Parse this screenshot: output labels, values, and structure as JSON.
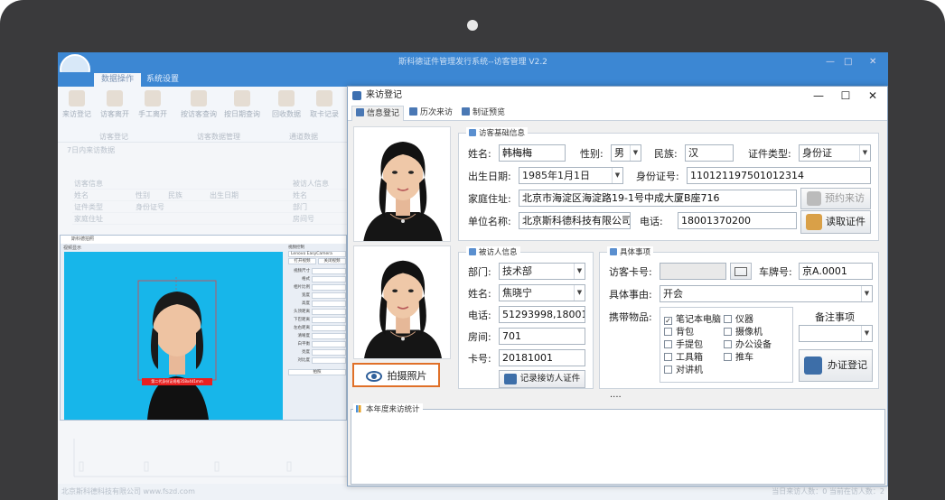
{
  "background_app": {
    "title": "斯科德证件管理发行系统--访客管理 V2.2",
    "tabs": [
      "数据操作",
      "系统设置"
    ],
    "ribbon": [
      "来访登记",
      "访客离开",
      "手工离开",
      "按访客查询",
      "按日期查询",
      "回收数据",
      "取卡记录"
    ],
    "ribbon_groups": [
      "访客登记",
      "访客数据管理",
      "通道数据"
    ],
    "panel_header": "7日内来访数据",
    "rows": [
      [
        "访客信息",
        "",
        "",
        "",
        "被访人信息"
      ],
      [
        "姓名",
        "性别",
        "民族",
        "出生日期",
        "姓名"
      ],
      [
        "证件类型",
        "身份证号",
        "",
        "",
        "部门"
      ],
      [
        "家庭住址",
        "",
        "",
        "",
        "房间号"
      ]
    ],
    "footer_left": "北京斯科德科技有限公司  www.fszd.com",
    "footer_right": "当日来访人数：0    当前在访人数：2"
  },
  "photo_tool": {
    "title": "斯科德拍照",
    "subtitle": "视频显示",
    "caption": "第二代身份证规格358x441mm",
    "camera": "Lenovo EasyCamera",
    "side_header": "视频控制",
    "side_items": [
      "视频尺寸",
      "格式",
      "相片比例",
      "宽度",
      "高度",
      "头顶距离",
      "下巴距离",
      "左右距离",
      "清晰度",
      "白平衡",
      "亮度",
      "对比度"
    ],
    "side_buttons": [
      "打开视频",
      "关闭视频"
    ],
    "apply_button": "拍照"
  },
  "dialog": {
    "title": "来访登记",
    "tabs": [
      "信息登记",
      "历次来访",
      "制证预览"
    ],
    "visitor_section": "访客基础信息",
    "labels": {
      "name": "姓名:",
      "gender": "性别:",
      "ethnicity": "民族:",
      "id_type": "证件类型:",
      "birth": "出生日期:",
      "id_no": "身份证号:",
      "address": "家庭住址:",
      "company": "单位名称:",
      "phone": "电话:"
    },
    "values": {
      "name": "韩梅梅",
      "gender": "男",
      "ethnicity": "汉",
      "id_type": "身份证",
      "birth": "1985年1月1日",
      "id_no": "110121197501012314",
      "address": "北京市海淀区海淀路19-1号中成大厦B座716",
      "company": "北京斯科德科技有限公司",
      "phone": "18001370200"
    },
    "btn_reserve": "预约来访",
    "btn_read": "读取证件",
    "host_section": "被访人信息",
    "host_labels": {
      "dept": "部门:",
      "name": "姓名:",
      "phone": "电话:",
      "room": "房间:",
      "card": "卡号:"
    },
    "host_values": {
      "dept": "技术部",
      "name": "焦晓宁",
      "phone": "51293998,18001370200",
      "room": "701",
      "card": "20181001"
    },
    "btn_record_host": "记录接访人证件",
    "btn_capture": "拍摄照片",
    "detail_section": "具体事项",
    "detail_labels": {
      "card": "访客卡号:",
      "plate": "车牌号:",
      "matter": "具体事由:",
      "items": "携带物品:",
      "remark": "备注事项"
    },
    "detail_values": {
      "card": "",
      "plate": "京A.0001",
      "matter": "开会"
    },
    "items": [
      {
        "label": "笔记本电脑",
        "checked": "✓"
      },
      {
        "label": "仪器",
        "checked": ""
      },
      {
        "label": "背包",
        "checked": ""
      },
      {
        "label": "摄像机",
        "checked": ""
      },
      {
        "label": "手提包",
        "checked": ""
      },
      {
        "label": "办公设备",
        "checked": ""
      },
      {
        "label": "工具箱",
        "checked": ""
      },
      {
        "label": "推车",
        "checked": ""
      },
      {
        "label": "对讲机",
        "checked": ""
      }
    ],
    "btn_issue": "办证登记",
    "ellipsis": "....",
    "stats_section": "本年度来访统计"
  },
  "colors": {
    "accent": "#3c87d3",
    "highlight": "#e07028",
    "background_blue": "#17b6ea"
  }
}
